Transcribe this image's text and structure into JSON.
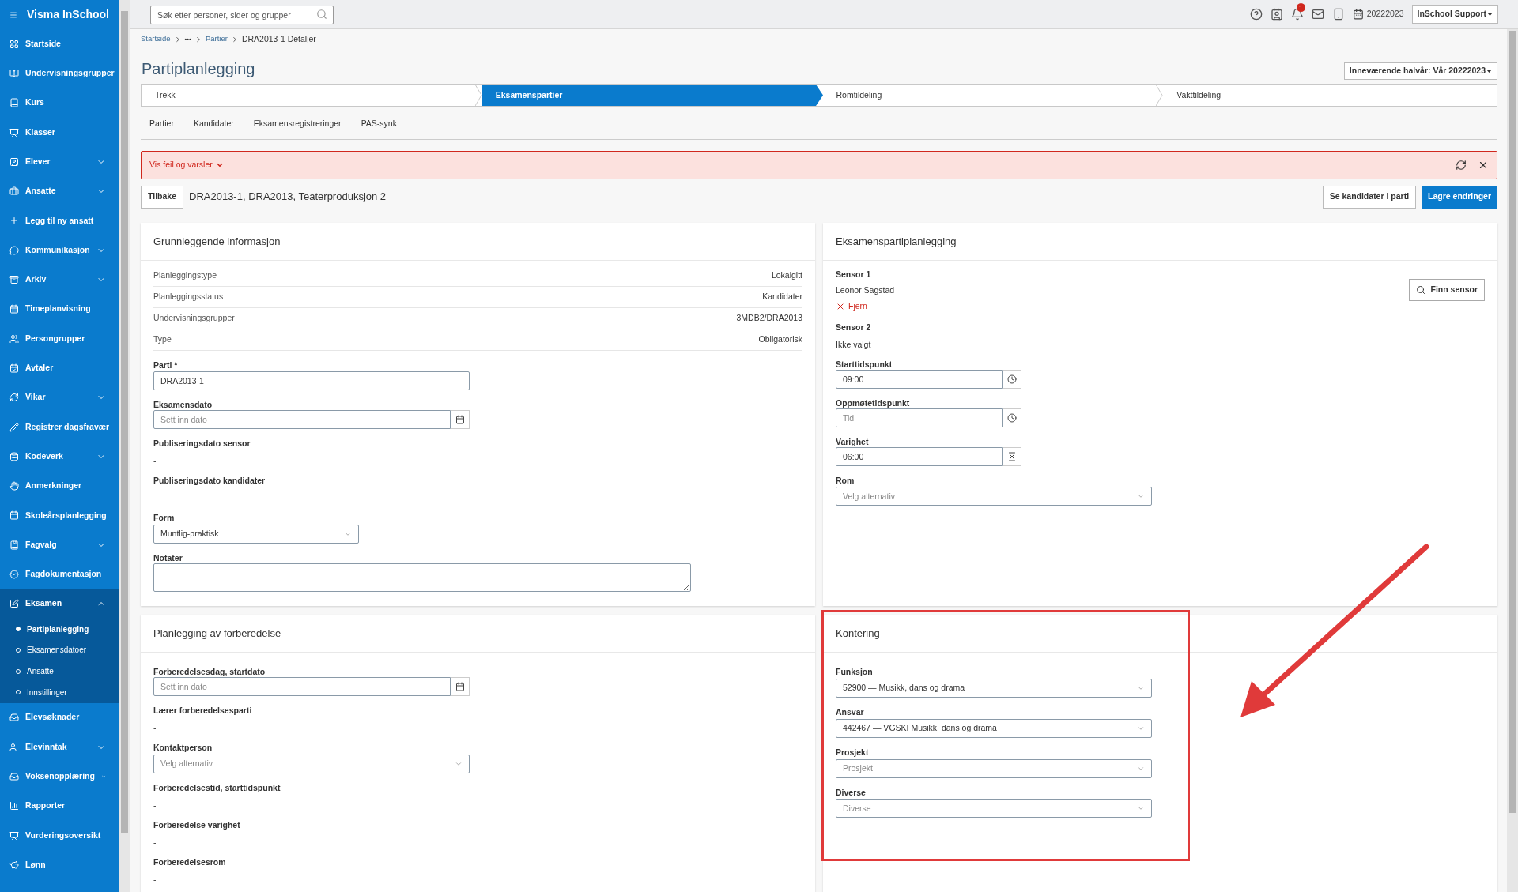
{
  "app": {
    "title": "Visma InSchool"
  },
  "sidebar": {
    "items": [
      {
        "label": "Startside"
      },
      {
        "label": "Undervisningsgrupper"
      },
      {
        "label": "Kurs"
      },
      {
        "label": "Klasser"
      },
      {
        "label": "Elever",
        "expanded": false
      },
      {
        "label": "Ansatte",
        "expanded": false
      },
      {
        "label": "Legg til ny ansatt"
      },
      {
        "label": "Kommunikasjon",
        "expanded": false
      },
      {
        "label": "Arkiv",
        "expanded": false
      },
      {
        "label": "Timeplanvisning"
      },
      {
        "label": "Persongrupper"
      },
      {
        "label": "Avtaler"
      },
      {
        "label": "Vikar",
        "expanded": false
      },
      {
        "label": "Registrer dagsfravær"
      },
      {
        "label": "Kodeverk",
        "expanded": false
      },
      {
        "label": "Anmerkninger"
      },
      {
        "label": "Skoleårsplanlegging"
      },
      {
        "label": "Fagvalg",
        "expanded": false
      },
      {
        "label": "Fagdokumentasjon"
      },
      {
        "label": "Eksamen",
        "expanded": true,
        "children": [
          {
            "label": "Partiplanlegging",
            "selected": true
          },
          {
            "label": "Eksamensdatoer",
            "selected": false
          },
          {
            "label": "Ansatte",
            "selected": false
          },
          {
            "label": "Innstillinger",
            "selected": false
          }
        ]
      },
      {
        "label": "Elevsøknader"
      },
      {
        "label": "Elevinntak",
        "expanded": false
      },
      {
        "label": "Voksenopplæring",
        "expanded": false
      },
      {
        "label": "Rapporter"
      },
      {
        "label": "Vurderingsoversikt"
      },
      {
        "label": "Lønn"
      }
    ]
  },
  "topbar": {
    "search": {
      "placeholder": "Søk etter personer, sider og grupper"
    },
    "notifications": "1",
    "school_year": "20222023",
    "user": "InSchool Support"
  },
  "breadcrumb": [
    {
      "kind": "link",
      "label": "Startside"
    },
    {
      "kind": "more",
      "label": "•••"
    },
    {
      "kind": "link",
      "label": "Partier"
    },
    {
      "kind": "current",
      "label": "DRA2013-1 Detaljer"
    }
  ],
  "page": {
    "title": "Partiplanlegging",
    "term": "Inneværende halvår: Vår 20222023"
  },
  "steps": [
    {
      "label": "Trekk",
      "selected": false
    },
    {
      "label": "Eksamenspartier",
      "selected": true
    },
    {
      "label": "Romtildeling",
      "selected": false
    },
    {
      "label": "Vakttildeling",
      "selected": false
    }
  ],
  "subtabs": [
    "Partier",
    "Kandidater",
    "Eksamensregistreringer",
    "PAS-synk"
  ],
  "alert": {
    "label": "Vis feil og varsler"
  },
  "actions": {
    "back": "Tilbake",
    "heading": "DRA2013-1, DRA2013, Teaterproduksjon 2",
    "buttons": [
      {
        "label": "Se kandidater i parti",
        "kind": "secondary"
      },
      {
        "label": "Lagre endringer",
        "kind": "primary"
      }
    ]
  },
  "panels": [
    {
      "title": "Grunnleggende informasjon",
      "highlighted": false,
      "fields": [
        {
          "kind": "info",
          "label": "Planleggingstype",
          "value": "Lokalgitt"
        },
        {
          "kind": "info",
          "label": "Planleggingsstatus",
          "value": "Kandidater"
        },
        {
          "kind": "info",
          "label": "Undervisningsgrupper",
          "value": "3MDB2/DRA2013"
        },
        {
          "kind": "info",
          "label": "Type",
          "value": "Obligatorisk"
        },
        {
          "kind": "text",
          "label": "Parti *",
          "value": "DRA2013-1"
        },
        {
          "kind": "date",
          "label": "Eksamensdato",
          "placeholder": "Sett inn dato"
        },
        {
          "kind": "static",
          "label": "Publiseringsdato sensor",
          "value": "-"
        },
        {
          "kind": "static",
          "label": "Publiseringsdato kandidater",
          "value": "-"
        },
        {
          "kind": "short_select",
          "label": "Form",
          "value": "Muntlig-praktisk"
        },
        {
          "kind": "textarea",
          "label": "Notater"
        }
      ]
    },
    {
      "title": "Eksamenspartiplanlegging",
      "highlighted": false,
      "fields": [
        {
          "kind": "sensor",
          "label": "Sensor 1",
          "value": "Leonor Sagstad",
          "remove": "Fjern",
          "button": "Finn sensor"
        },
        {
          "kind": "static",
          "label": "Sensor 2",
          "value": "Ikke valgt"
        },
        {
          "kind": "time",
          "label": "Starttidspunkt",
          "value": "09:00"
        },
        {
          "kind": "time",
          "label": "Oppmøtetidspunkt",
          "placeholder": "Tid"
        },
        {
          "kind": "duration",
          "label": "Varighet",
          "value": "06:00"
        },
        {
          "kind": "select",
          "label": "Rom",
          "placeholder": "Velg alternativ"
        }
      ]
    },
    {
      "title": "Planlegging av forberedelse",
      "highlighted": false,
      "fields": [
        {
          "kind": "date",
          "label": "Forberedelsesdag, startdato",
          "placeholder": "Sett inn dato"
        },
        {
          "kind": "static",
          "label": "Lærer forberedelsesparti",
          "value": "-"
        },
        {
          "kind": "select",
          "label": "Kontaktperson",
          "placeholder": "Velg alternativ"
        },
        {
          "kind": "static",
          "label": "Forberedelsestid, starttidspunkt",
          "value": "-"
        },
        {
          "kind": "static",
          "label": "Forberedelse varighet",
          "value": "-"
        },
        {
          "kind": "static",
          "label": "Forberedelsesrom",
          "value": "-"
        }
      ]
    },
    {
      "title": "Kontering",
      "highlighted": true,
      "fields": [
        {
          "kind": "select",
          "label": "Funksjon",
          "value": "52900 — Musikk, dans og drama"
        },
        {
          "kind": "select",
          "label": "Ansvar",
          "value": "442467 — VGSKI Musikk, dans og drama"
        },
        {
          "kind": "select",
          "label": "Prosjekt",
          "placeholder": "Prosjekt"
        },
        {
          "kind": "select",
          "label": "Diverse",
          "placeholder": "Diverse"
        }
      ]
    }
  ]
}
